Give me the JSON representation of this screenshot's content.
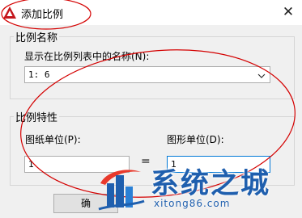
{
  "window": {
    "title": "添加比例",
    "close_glyph": "✕"
  },
  "scale_name": {
    "group_label": "比例名称",
    "field_label": "显示在比例列表中的名称(N):",
    "select_value": "1: 6"
  },
  "scale_props": {
    "group_label": "比例特性",
    "paper_units_label": "图纸单位(P):",
    "paper_units_value": "1",
    "eq": "=",
    "drawing_units_label": "图形单位(D):",
    "drawing_units_value": "1"
  },
  "buttons": {
    "ok_label": "确"
  },
  "watermark": {
    "brand": "系统之城",
    "url": "xitong86.com"
  },
  "colors": {
    "accent": "#0078d7",
    "annotation": "#d40000",
    "watermark": "#1f5fae"
  }
}
